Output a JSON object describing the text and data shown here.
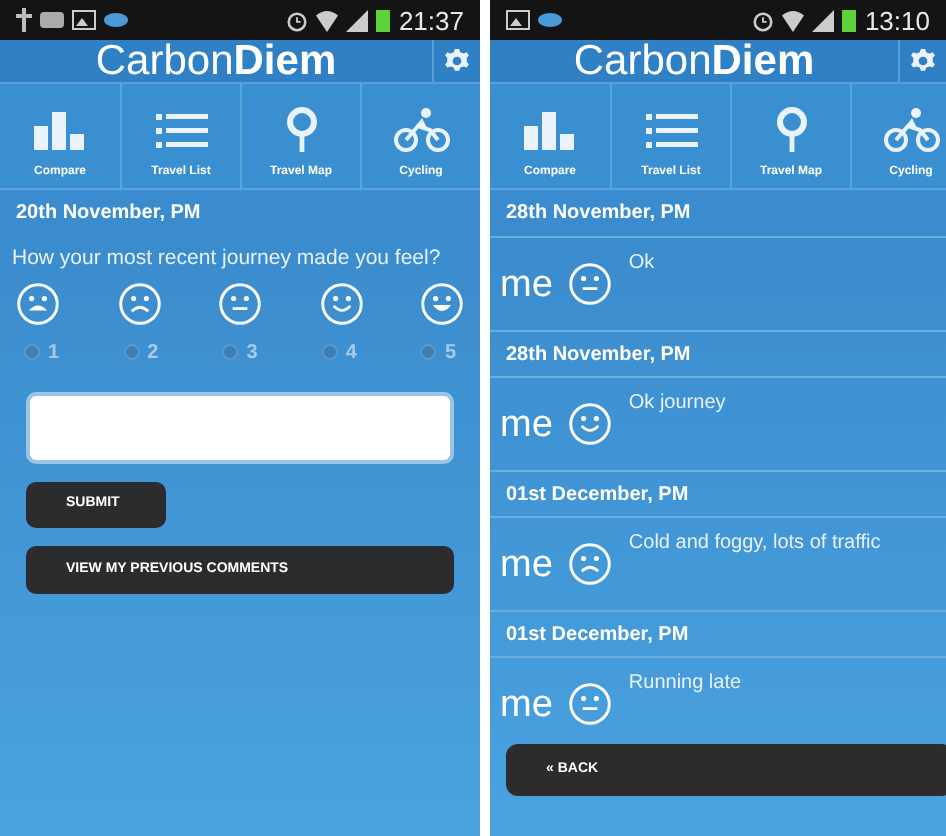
{
  "feedback_screen": {
    "status_bar": {
      "time": "21:37"
    },
    "app_title": "Carbon**Diem**",
    "nav": [
      {
        "label": "Compare",
        "kind": "bars"
      },
      {
        "label": "Travel List",
        "kind": "list"
      },
      {
        "label": "Travel Map",
        "kind": "pin"
      },
      {
        "label": "Cycling",
        "kind": "bike"
      }
    ],
    "date": "20th November, PM",
    "question": "How your most recent journey made you feel?",
    "moods": [
      {
        "kind": "very_sad"
      },
      {
        "kind": "sad"
      },
      {
        "kind": "neutral"
      },
      {
        "kind": "happy"
      },
      {
        "kind": "very_happy"
      }
    ],
    "ratings": [
      {
        "label": "1",
        "selected": false
      },
      {
        "label": "2",
        "selected": false
      },
      {
        "label": "3",
        "selected": false
      },
      {
        "label": "4",
        "selected": false
      },
      {
        "label": "5",
        "selected": false
      }
    ],
    "submit_button": "SUBMIT",
    "comments_button": "VIEW MY PREVIOUS COMMENTS"
  },
  "comments_screen": {
    "status_bar": {
      "time": "13:10"
    },
    "app_title": "Carbon**Diem**",
    "nav": [
      {
        "label": "Compare",
        "kind": "bars"
      },
      {
        "label": "Travel List",
        "kind": "list"
      },
      {
        "label": "Travel Map",
        "kind": "pin"
      },
      {
        "label": "Cycling",
        "kind": "bike"
      }
    ],
    "comments": [
      {
        "date": "28th November, PM",
        "author": "me",
        "kind": "neutral",
        "text": "Ok"
      },
      {
        "date": "28th November, PM",
        "author": "me",
        "kind": "happy",
        "text": "Ok journey"
      },
      {
        "date": "01st December, PM",
        "author": "me",
        "kind": "sad",
        "text": "Cold and foggy, lots of traffic"
      },
      {
        "date": "01st December, PM",
        "author": "me",
        "kind": "neutral",
        "text": "Running late"
      }
    ],
    "back_button": "« BACK"
  }
}
